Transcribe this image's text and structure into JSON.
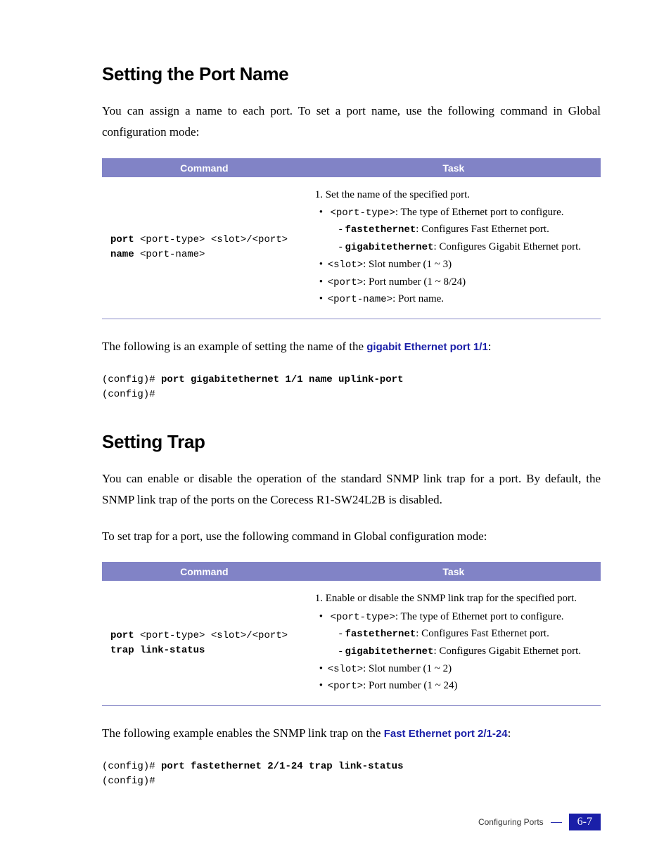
{
  "section1": {
    "heading": "Setting the Port Name",
    "intro": "You can assign a name to each port. To set a port name, use the following command in Global configuration mode:",
    "table": {
      "headers": {
        "c1": "Command",
        "c2": "Task"
      },
      "cmd_l1": "port <port-type> <slot>/<port>",
      "cmd_l2": "name <port-name>",
      "task_main": "1. Set the name of the specified port.",
      "b1_code": "<port-type>",
      "b1_text": ": The type of Ethernet port to configure.",
      "b1_sub1_code": "fastethernet",
      "b1_sub1_text": ": Configures Fast Ethernet port.",
      "b1_sub2_code": "gigabitethernet",
      "b1_sub2_text": ": Configures Gigabit Ethernet port.",
      "b2_code": "<slot>",
      "b2_text": ": Slot number (1 ~ 3)",
      "b3_code": "<port>",
      "b3_text": ": Port number (1 ~ 8/24)",
      "b4_code": "<port-name>",
      "b4_text": ": Port name."
    },
    "example_pre": "The following is an example of setting the name of the ",
    "example_bold": "gigabit Ethernet port 1/1",
    "example_post": ":",
    "code_prompt1": "(config)# ",
    "code_cmd": "port gigabitethernet 1/1 name uplink-port",
    "code_prompt2": "(config)#"
  },
  "section2": {
    "heading": "Setting Trap",
    "intro": "You can enable or disable the operation of the standard SNMP link trap for a port. By default, the SNMP link trap of the ports on the Corecess R1-SW24L2B is disabled.",
    "intro2": "To set trap for a port, use the following command in Global configuration mode:",
    "table": {
      "headers": {
        "c1": "Command",
        "c2": "Task"
      },
      "cmd_l1": "port <port-type> <slot>/<port>",
      "cmd_l2": "trap link-status",
      "task_main": "1. Enable or disable the SNMP link trap for the specified port.",
      "b1_code": "<port-type>",
      "b1_text": ": The type of Ethernet port to configure.",
      "b1_sub1_code": "fastethernet",
      "b1_sub1_text": ": Configures Fast Ethernet port.",
      "b1_sub2_code": "gigabitethernet",
      "b1_sub2_text": ": Configures Gigabit Ethernet port.",
      "b2_code": "<slot>",
      "b2_text": ": Slot number (1 ~ 2)",
      "b3_code": "<port>",
      "b3_text": ": Port number (1 ~ 24)"
    },
    "example_pre": "The following example enables the SNMP link trap on the ",
    "example_bold": "Fast Ethernet port 2/1-24",
    "example_post": ":",
    "code_prompt1": "(config)# ",
    "code_cmd": "port fastethernet 2/1-24 trap link-status",
    "code_prompt2": "(config)#"
  },
  "footer": {
    "label": "Configuring Ports",
    "page": "6-7"
  }
}
